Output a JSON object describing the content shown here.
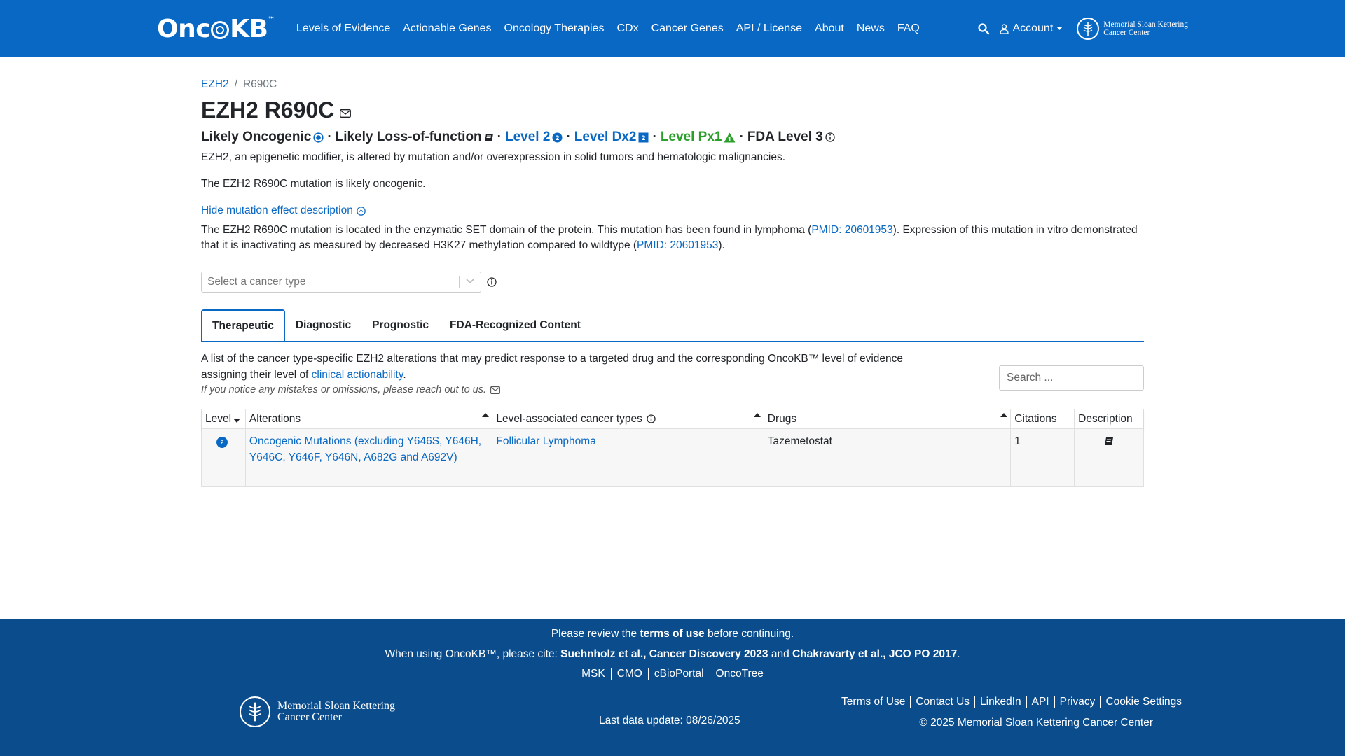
{
  "nav": {
    "logo_text_1": "Onc",
    "logo_text_2": "KB",
    "logo_tm": "™",
    "links": [
      "Levels of Evidence",
      "Actionable Genes",
      "Oncology Therapies",
      "CDx",
      "Cancer Genes",
      "API / License",
      "About",
      "News",
      "FAQ"
    ],
    "account_label": "Account",
    "msk_line1": "Memorial Sloan Kettering",
    "msk_line2": "Cancer Center"
  },
  "breadcrumb": {
    "gene": "EZH2",
    "sep": "/",
    "current": "R690C"
  },
  "title": "EZH2 R690C",
  "badges": {
    "oncogenic": "Likely Oncogenic",
    "effect": "Likely Loss-of-function",
    "level": "Level 2",
    "level_dx": "Level Dx2",
    "level_px": "Level Px1",
    "fda": "FDA Level 3",
    "dot": "·"
  },
  "summary": "EZH2, an epigenetic modifier, is altered by mutation and/or overexpression in solid tumors and hematologic malignancies.",
  "oncogenic_summary": "The EZH2 R690C mutation is likely oncogenic.",
  "hide_desc_label": "Hide mutation effect description",
  "effect_desc": {
    "part1": "The EZH2 R690C mutation is located in the enzymatic SET domain of the protein. This mutation has been found in lymphoma (",
    "pmid1": "PMID: 20601953",
    "part2": "). Expression of this mutation in vitro demonstrated that it is inactivating as measured by decreased H3K27 methylation compared to wildtype (",
    "pmid2": "PMID: 20601953",
    "part3": ")."
  },
  "cancer_select_placeholder": "Select a cancer type",
  "tabs": [
    "Therapeutic",
    "Diagnostic",
    "Prognostic",
    "FDA-Recognized Content"
  ],
  "list_desc": {
    "part1": "A list of the cancer type-specific EZH2 alterations that may predict response to a targeted drug and the corresponding OncoKB™ level of evidence assigning their level of ",
    "link": "clinical actionability",
    "part2": "."
  },
  "notice": "If you notice any mistakes or omissions, please reach out to us.",
  "search_placeholder": "Search ...",
  "table": {
    "headers": [
      "Level",
      "Alterations",
      "Level-associated cancer types",
      "Drugs",
      "Citations",
      "Description"
    ],
    "rows": [
      {
        "level": "2",
        "alterations": "Oncogenic Mutations (excluding Y646S, Y646H, Y646C, Y646F, Y646N, A682G and A692V)",
        "cancer_type": "Follicular Lymphoma",
        "drugs": "Tazemetostat",
        "citations": "1"
      }
    ]
  },
  "footer": {
    "review_pre": "Please review the ",
    "review_link": "terms of use",
    "review_post": " before continuing.",
    "cite_pre": "When using OncoKB™, please cite: ",
    "cite_1": "Suehnholz et al., Cancer Discovery 2023",
    "cite_and": " and ",
    "cite_2": "Chakravarty et al., JCO PO 2017",
    "cite_end": ".",
    "links": [
      "MSK",
      "CMO",
      "cBioPortal",
      "OncoTree"
    ],
    "msk_line1": "Memorial Sloan Kettering",
    "msk_line2": "Cancer Center",
    "last_update": "Last data update: 08/26/2025",
    "right_links": [
      "Terms of Use",
      "Contact Us",
      "LinkedIn",
      "API",
      "Privacy",
      "Cookie Settings"
    ],
    "copyright": "© 2025 Memorial Sloan Kettering Cancer Center"
  },
  "colors": {
    "primary": "#0968c3",
    "footer_bg": "#0b4d8c",
    "px_green": "#2aa02a"
  }
}
